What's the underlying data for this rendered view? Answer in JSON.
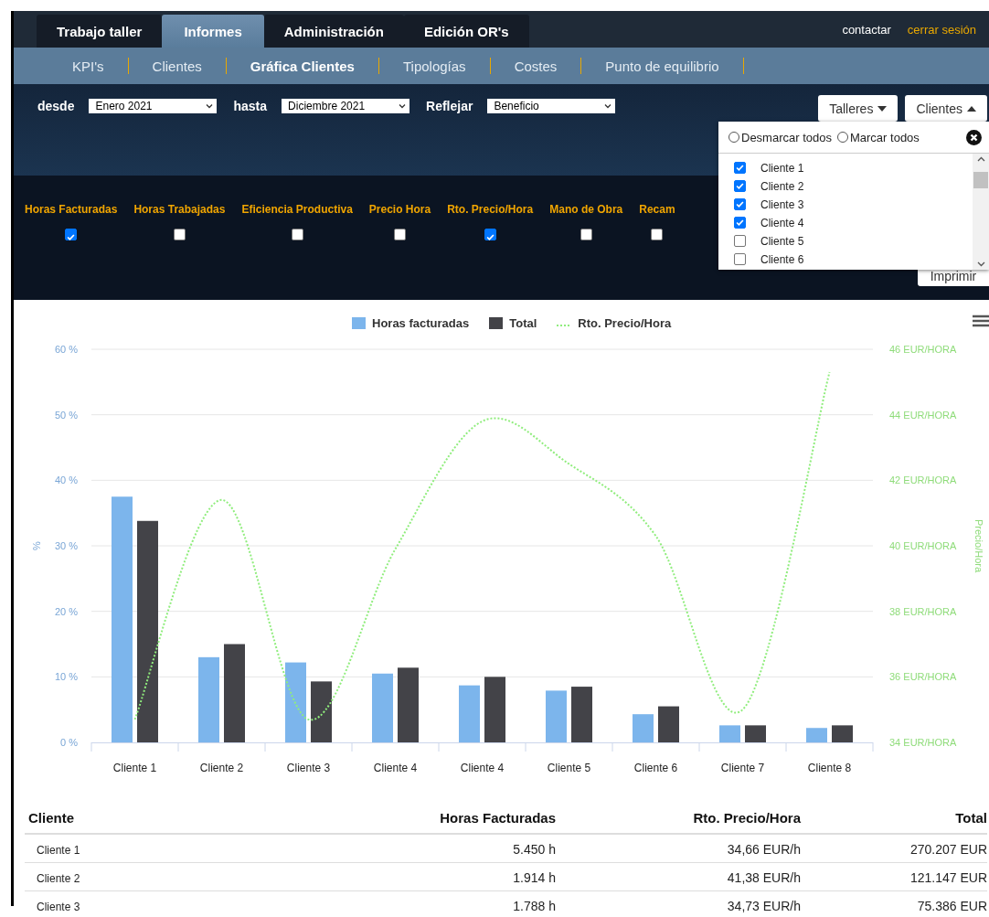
{
  "header": {
    "tabs": [
      {
        "label": "Trabajo taller",
        "selected": false
      },
      {
        "label": "Informes",
        "selected": true
      },
      {
        "label": "Administración",
        "selected": false
      },
      {
        "label": "Edición OR's",
        "selected": false
      }
    ],
    "links": [
      {
        "label": "contactar",
        "kind": "plain"
      },
      {
        "label": "cerrar sesión",
        "kind": "accent"
      }
    ]
  },
  "subnav": [
    {
      "label": "KPI's",
      "selected": false
    },
    {
      "label": "Clientes",
      "selected": false
    },
    {
      "label": "Gráfica Clientes",
      "selected": true
    },
    {
      "label": "Tipologías",
      "selected": false
    },
    {
      "label": "Costes",
      "selected": false
    },
    {
      "label": "Punto de equilibrio",
      "selected": false
    }
  ],
  "filters": [
    {
      "label": "desde",
      "value": "Enero 2021"
    },
    {
      "label": "hasta",
      "value": "Diciembre 2021"
    },
    {
      "label": "Reflejar",
      "value": "Beneficio"
    }
  ],
  "buttons": [
    {
      "label": "Talleres",
      "expanded": false
    },
    {
      "label": "Clientes",
      "expanded": true
    }
  ],
  "metrics": [
    {
      "label": "Horas Facturadas",
      "checked": true
    },
    {
      "label": "Horas Trabajadas",
      "checked": false
    },
    {
      "label": "Eficiencia Productiva",
      "checked": false
    },
    {
      "label": "Precio Hora",
      "checked": false
    },
    {
      "label": "Rto. Precio/Hora",
      "checked": true
    },
    {
      "label": "Mano de Obra",
      "checked": false
    },
    {
      "label": "Recam",
      "checked": false
    }
  ],
  "print_button": "Imprimir",
  "client_menu": {
    "options": [
      {
        "label": "Desmarcar todos",
        "selected": false
      },
      {
        "label": "Marcar todos",
        "selected": false
      }
    ],
    "items": [
      {
        "label": "Cliente 1",
        "checked": true
      },
      {
        "label": "Cliente 2",
        "checked": true
      },
      {
        "label": "Cliente 3",
        "checked": true
      },
      {
        "label": "Cliente 4",
        "checked": true
      },
      {
        "label": "Cliente 5",
        "checked": false
      },
      {
        "label": "Cliente 6",
        "checked": false
      }
    ]
  },
  "chart": {
    "chart_data": {
      "type": "bar",
      "grid": true,
      "legend": "top",
      "ylabel": "%",
      "categories": [
        "Cliente 1",
        "Cliente 2",
        "Cliente 3",
        "Cliente 4",
        "Cliente 4",
        "Cliente 5",
        "Cliente 6",
        "Cliente 7",
        "Cliente 8"
      ],
      "ylim": [
        0,
        60
      ],
      "yticks": [
        {
          "value": 0,
          "label": "0 %"
        },
        {
          "value": 10,
          "label": "10 %"
        },
        {
          "value": 20,
          "label": "20 %"
        },
        {
          "value": 30,
          "label": "30 %"
        },
        {
          "value": 40,
          "label": "40 %"
        },
        {
          "value": 50,
          "label": "50 %"
        },
        {
          "value": 60,
          "label": "60 %"
        }
      ],
      "series": [
        {
          "name": "Horas facturadas",
          "color": "#7cb5ec",
          "values": [
            37.5,
            13,
            12.2,
            10.5,
            8.7,
            7.9,
            4.3,
            2.6,
            2.2
          ]
        },
        {
          "name": "Total",
          "color": "#434348",
          "values": [
            33.8,
            15,
            9.3,
            11.4,
            10,
            8.5,
            5.5,
            2.6,
            2.6
          ]
        }
      ]
    }
  },
  "chart_overlay": {
    "chart_data": {
      "type": "line",
      "ylabel": "Precio/Hora",
      "ylim": [
        34,
        46
      ],
      "yticks": [
        {
          "value": 34,
          "label": "34 EUR/HORA"
        },
        {
          "value": 36,
          "label": "36 EUR/HORA"
        },
        {
          "value": 38,
          "label": "38 EUR/HORA"
        },
        {
          "value": 40,
          "label": "40 EUR/HORA"
        },
        {
          "value": 42,
          "label": "42 EUR/HORA"
        },
        {
          "value": 44,
          "label": "44 EUR/HORA"
        },
        {
          "value": 46,
          "label": "46 EUR/HORA"
        }
      ],
      "series": [
        {
          "name": "Rto. Precio/Hora",
          "color": "#90ed7d",
          "line_style": "dotted",
          "values": [
            34.7,
            41.4,
            34.7,
            39.9,
            43.8,
            42.5,
            40.3,
            35.0,
            45.3
          ]
        }
      ]
    }
  },
  "table": {
    "columns": [
      "Cliente",
      "Horas Facturadas",
      "Rto. Precio/Hora",
      "Total"
    ],
    "rows": [
      [
        "Cliente 1",
        "5.450 h",
        "34,66 EUR/h",
        "270.207 EUR"
      ],
      [
        "Cliente 2",
        "1.914 h",
        "41,38 EUR/h",
        "121.147 EUR"
      ],
      [
        "Cliente 3",
        "1.788 h",
        "34,73 EUR/h",
        "75.386 EUR"
      ]
    ]
  }
}
